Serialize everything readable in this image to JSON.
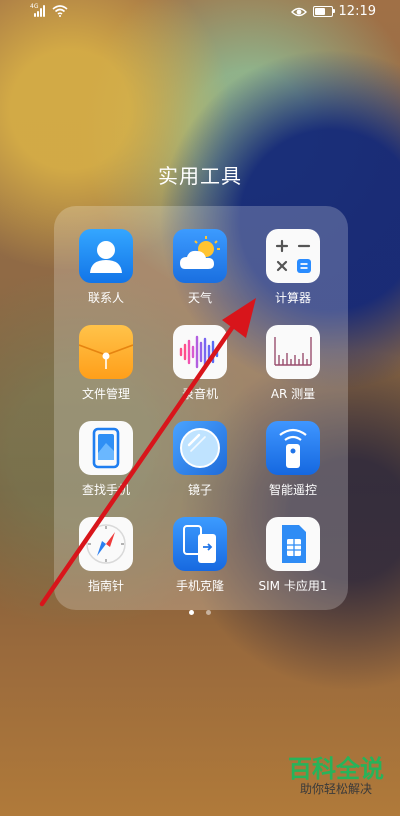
{
  "status_bar": {
    "network_tag": "4G",
    "time": "12:19",
    "battery_level": 0.6,
    "icons": [
      "signal-icon",
      "wifi-icon",
      "eye-comfort-icon",
      "battery-icon"
    ]
  },
  "folder": {
    "title": "实用工具",
    "apps": [
      {
        "label": "联系人",
        "icon": "contacts-icon"
      },
      {
        "label": "天气",
        "icon": "weather-icon"
      },
      {
        "label": "计算器",
        "icon": "calculator-icon"
      },
      {
        "label": "文件管理",
        "icon": "file-manager-icon"
      },
      {
        "label": "录音机",
        "icon": "recorder-icon"
      },
      {
        "label": "AR 测量",
        "icon": "ar-measure-icon"
      },
      {
        "label": "查找手机",
        "icon": "find-phone-icon"
      },
      {
        "label": "镜子",
        "icon": "mirror-icon"
      },
      {
        "label": "智能遥控",
        "icon": "smart-remote-icon"
      },
      {
        "label": "指南针",
        "icon": "compass-icon"
      },
      {
        "label": "手机克隆",
        "icon": "phone-clone-icon"
      },
      {
        "label": "SIM 卡应用1",
        "icon": "sim-app-icon"
      }
    ],
    "page_count": 2,
    "current_page": 1
  },
  "annotation": {
    "type": "arrow",
    "color": "#d8151b"
  },
  "watermark": {
    "title": "百科全说",
    "subtitle": "助你轻松解决"
  },
  "colors": {
    "accent_green": "#27b35a",
    "arrow_red": "#d8151b"
  }
}
